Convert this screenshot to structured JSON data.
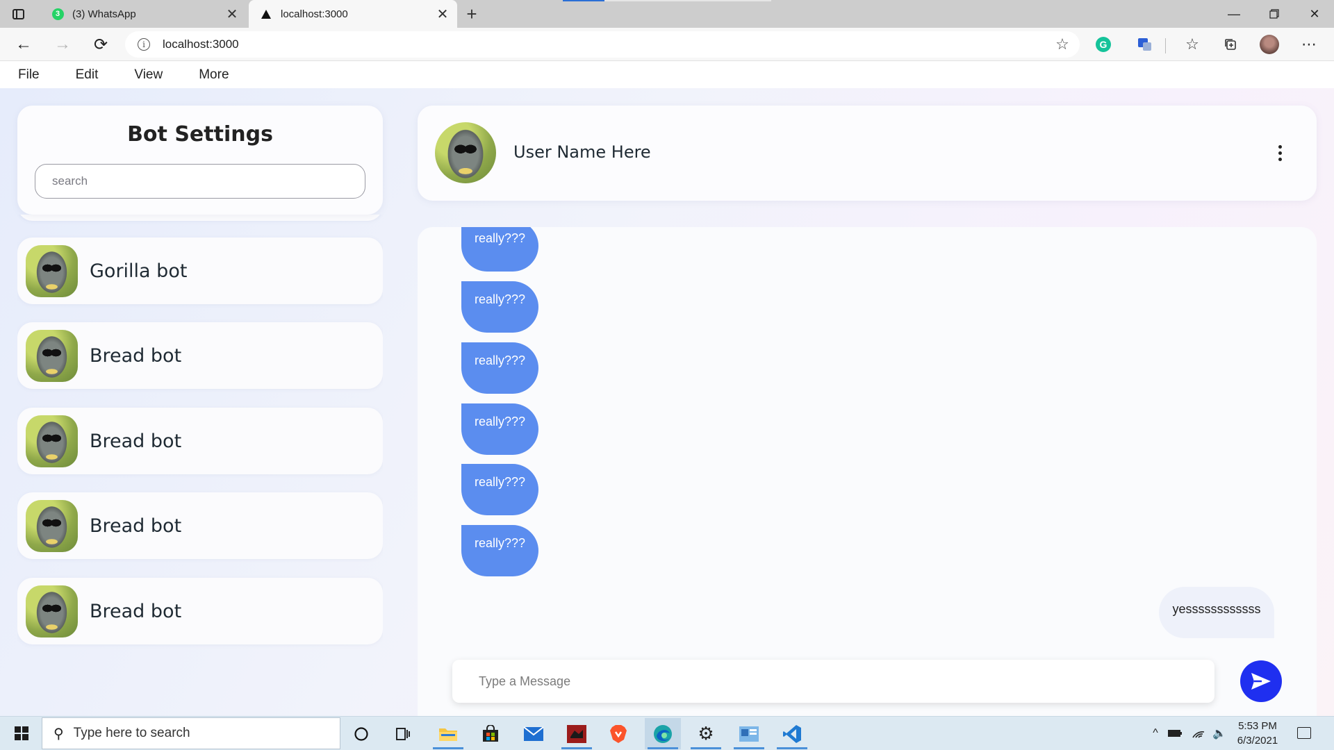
{
  "browser": {
    "tabs": [
      {
        "title": "(3) WhatsApp",
        "badge": "3",
        "favicon": "whatsapp-icon",
        "active": false
      },
      {
        "title": "localhost:3000",
        "favicon": "triangle-icon",
        "active": true
      }
    ],
    "url": "localhost:3000",
    "menu": [
      "File",
      "Edit",
      "View",
      "More"
    ]
  },
  "sidebar": {
    "title": "Bot Settings",
    "search_placeholder": "search",
    "bots": [
      {
        "name": ""
      },
      {
        "name": "Gorilla bot"
      },
      {
        "name": "Bread bot"
      },
      {
        "name": "Bread bot"
      },
      {
        "name": "Bread bot"
      },
      {
        "name": "Bread bot"
      }
    ]
  },
  "chat": {
    "user_name": "User Name Here",
    "messages": [
      {
        "from": "bot",
        "text": "really???"
      },
      {
        "from": "bot",
        "text": "really???"
      },
      {
        "from": "bot",
        "text": "really???"
      },
      {
        "from": "bot",
        "text": "really???"
      },
      {
        "from": "bot",
        "text": "really???"
      },
      {
        "from": "bot",
        "text": "really???"
      },
      {
        "from": "user",
        "text": "yessssssssssss"
      }
    ],
    "composer_placeholder": "Type a Message"
  },
  "taskbar": {
    "search_placeholder": "Type here to search",
    "time": "5:53 PM",
    "date": "6/3/2021"
  },
  "colors": {
    "bot_bubble": "#5b8def",
    "user_bubble": "#eef1fa",
    "send_button": "#1f2ff0"
  }
}
